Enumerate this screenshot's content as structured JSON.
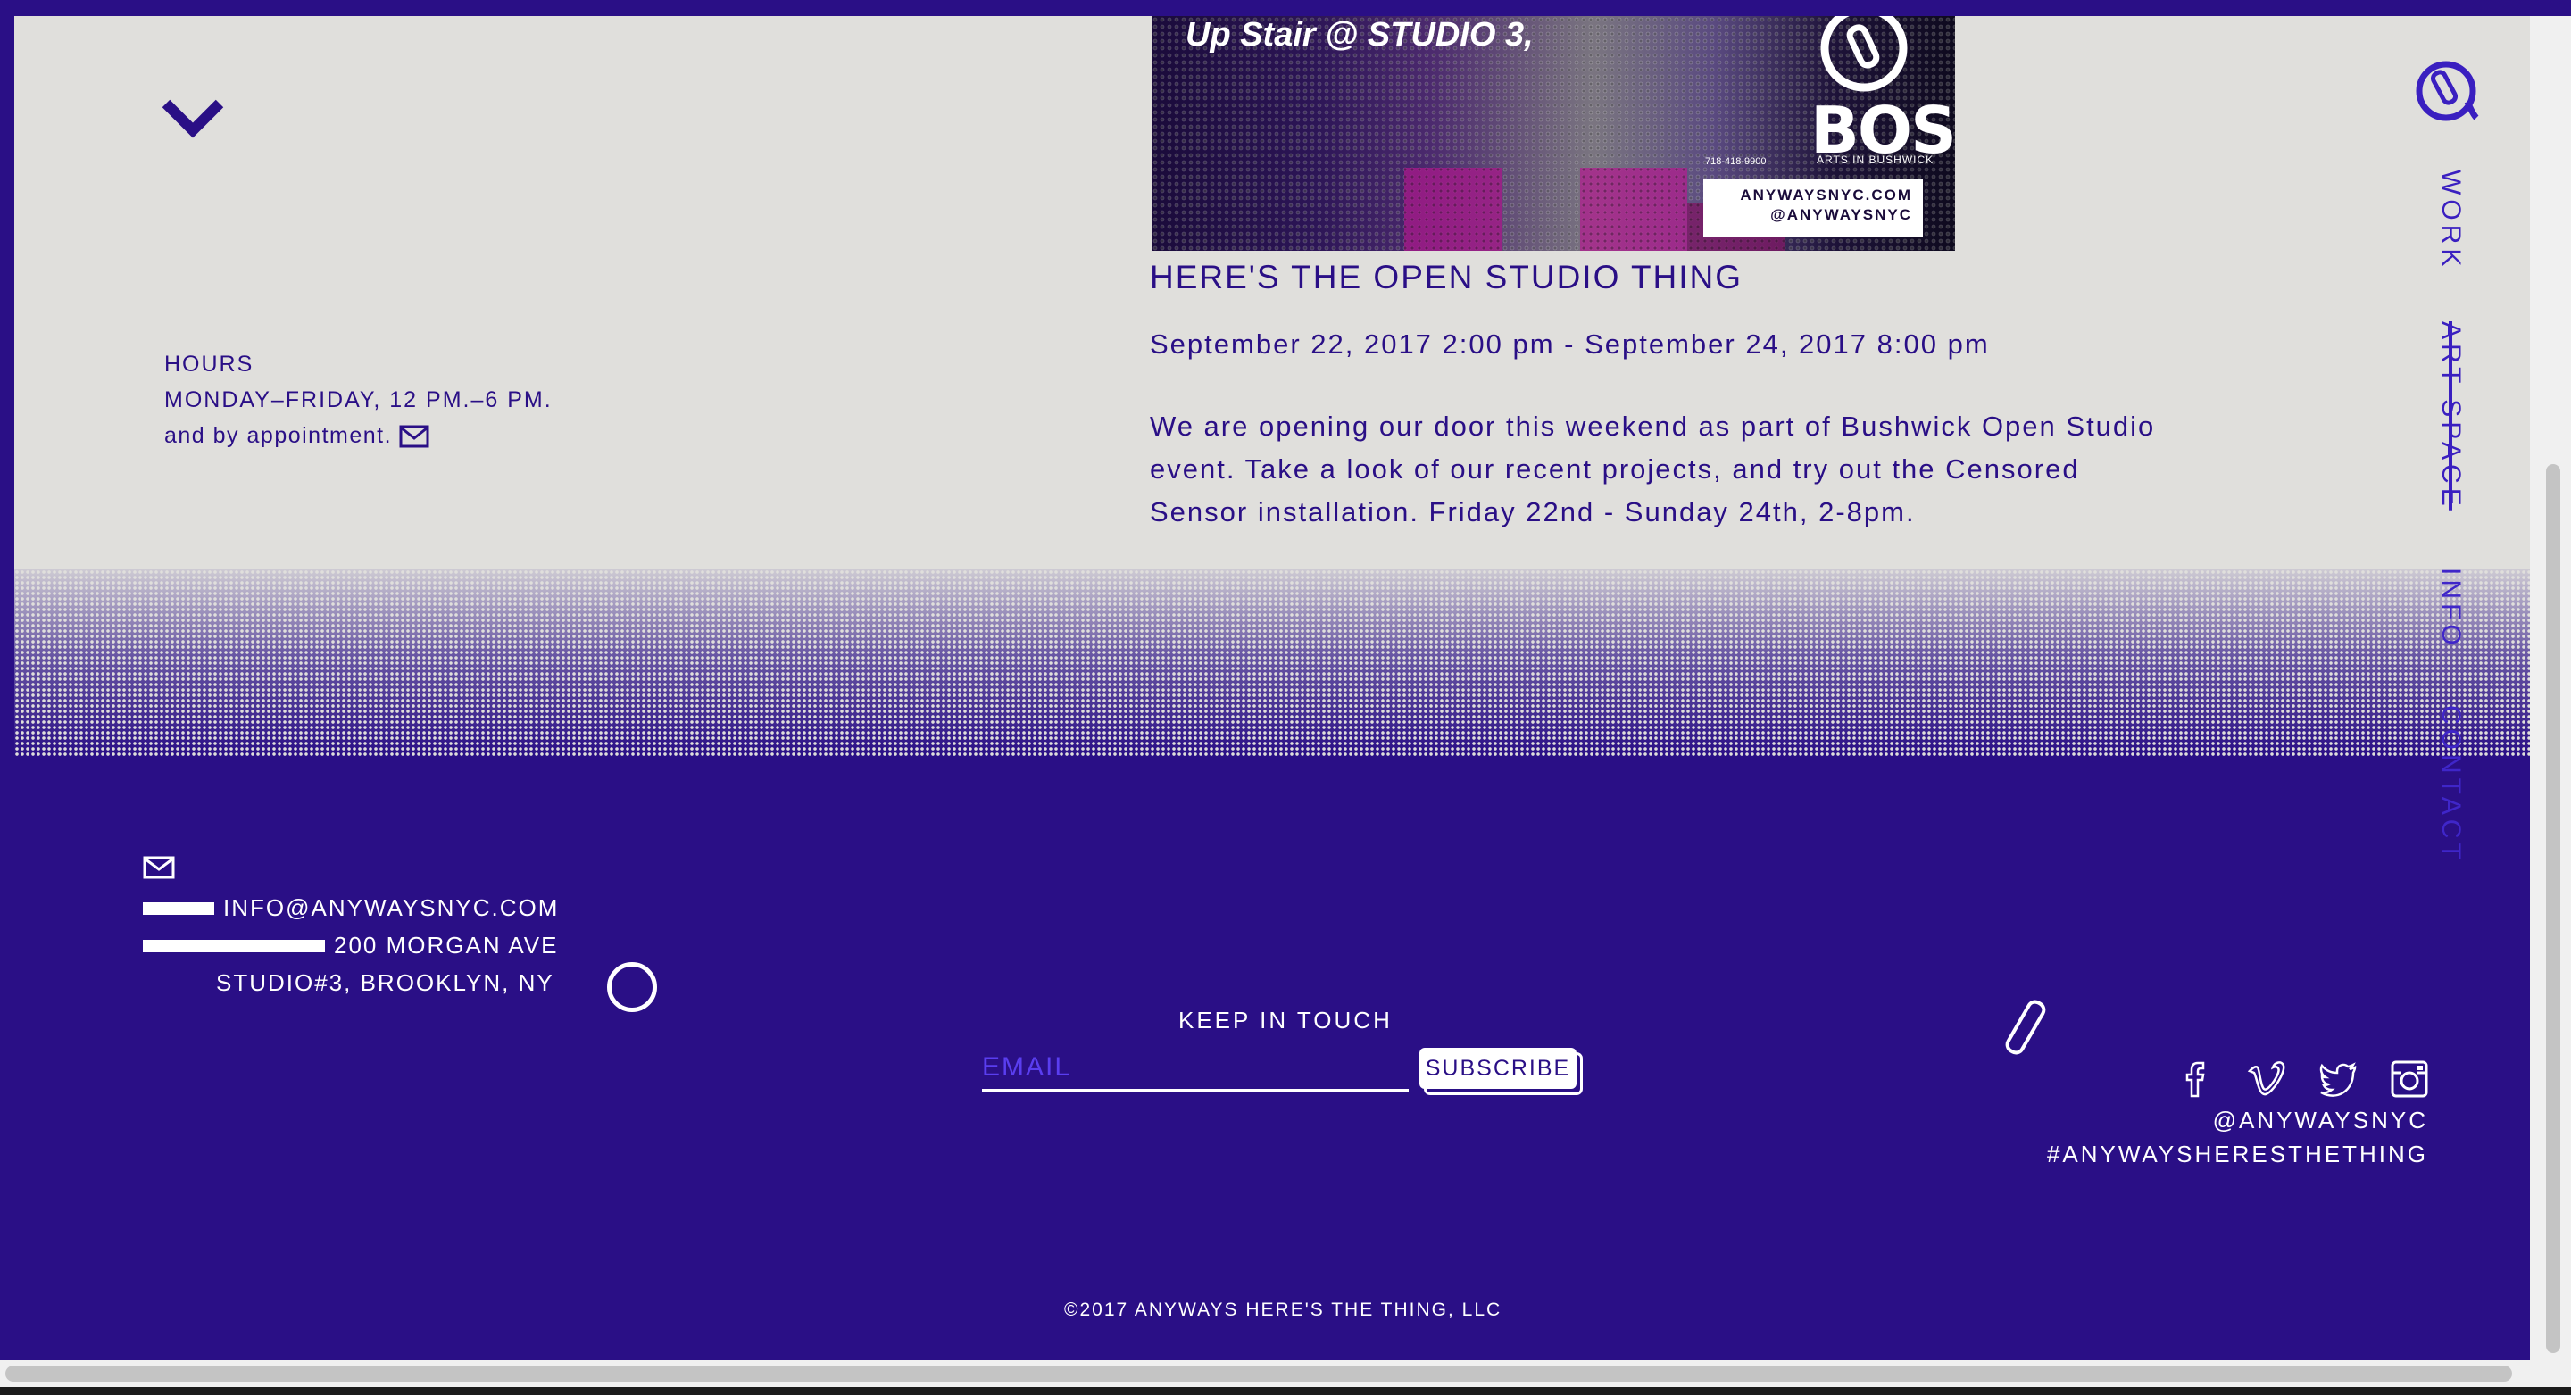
{
  "hours": {
    "heading": "HOURS",
    "days": "MONDAY–FRIDAY, 12 PM.–6 PM.",
    "appointment": "and by appointment."
  },
  "event": {
    "poster": {
      "headline": "Up Stair @ STUDIO 3,",
      "brand": "BOS",
      "arts": "ARTS IN BUSHWICK",
      "phone": "718-418-9900",
      "site": "ANYWAYSNYC.COM",
      "handle": "@ANYWAYSNYC"
    },
    "title": "HERE'S THE OPEN STUDIO THING",
    "date": "September 22, 2017 2:00 pm - September 24, 2017 8:00 pm",
    "description": "We are opening our door this weekend as part of Bushwick Open Studio event. Take a look of our recent projects, and try out the Censored Sensor installation. Friday 22nd - Sunday 24th, 2-8pm."
  },
  "nav": {
    "work": "WORK",
    "art_space": "ART SPACE",
    "info": "INFO",
    "contact": "CONTACT"
  },
  "contact": {
    "email": "INFO@ANYWAYSNYC.COM",
    "address_line1": "200 MORGAN AVE",
    "address_line2": "STUDIO#3, BROOKLYN, NY"
  },
  "newsletter": {
    "heading": "KEEP IN TOUCH",
    "placeholder": "EMAIL",
    "button": "SUBSCRIBE"
  },
  "social": {
    "icons": [
      "facebook-icon",
      "vimeo-icon",
      "twitter-icon",
      "instagram-icon"
    ],
    "handle": "@ANYWAYSNYC",
    "hashtag": "#ANYWAYSHERESTHETHING"
  },
  "footer": {
    "copyright": "©2017 ANYWAYS HERE'S THE THING, LLC"
  },
  "colors": {
    "brand_purple": "#2a0f86",
    "background_light": "#e0dfdc",
    "nav_purple": "#3a1fc0",
    "white": "#ffffff"
  }
}
